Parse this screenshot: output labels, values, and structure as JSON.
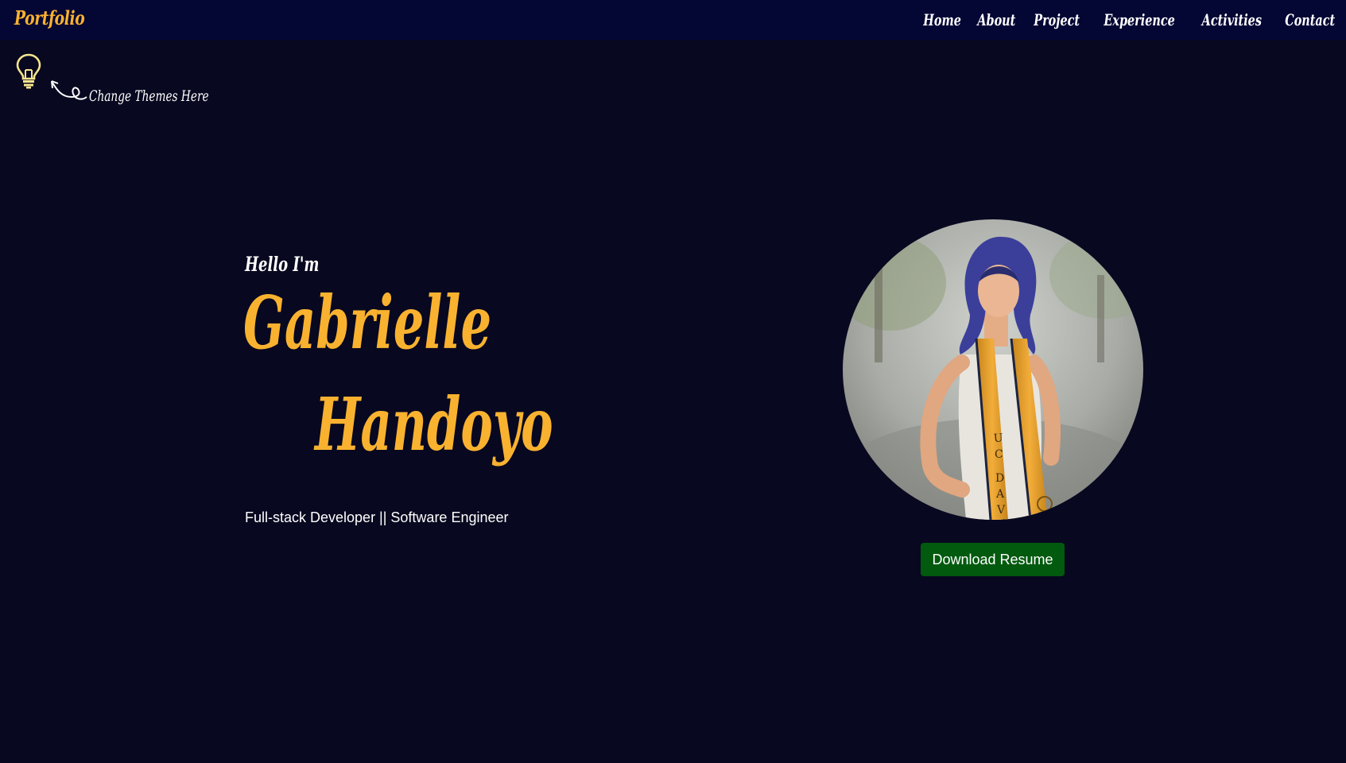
{
  "nav": {
    "brand": "Portfolio",
    "links": [
      {
        "label": "Home"
      },
      {
        "label": "About"
      },
      {
        "label": "Project"
      },
      {
        "label": "Experience"
      },
      {
        "label": "Activities"
      },
      {
        "label": "Contact"
      }
    ]
  },
  "theme": {
    "icon": "lightbulb-icon",
    "hint": "Change Themes Here"
  },
  "hero": {
    "greeting": "Hello I'm",
    "first_name": "Gabrielle",
    "last_name": "Handoyo",
    "tagline": "Full-stack Developer || Software Engineer",
    "download_label": "Download Resume",
    "stole_text": "UC DAV"
  },
  "colors": {
    "background": "#080820",
    "navbar": "#040634",
    "accent": "#f9b22f",
    "button": "#015a0e"
  }
}
